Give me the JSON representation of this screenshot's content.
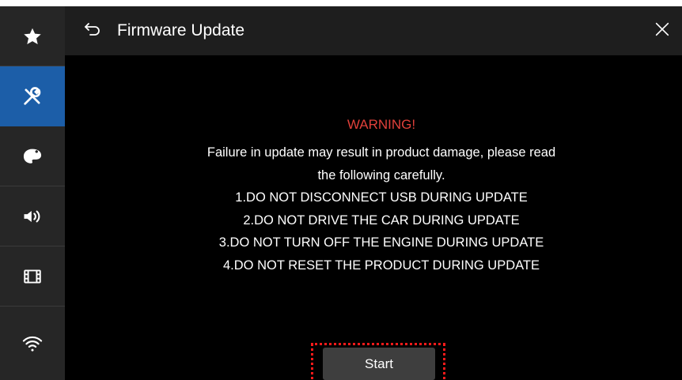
{
  "header": {
    "title": "Firmware Update",
    "back_icon": "back-arrow-icon",
    "close_icon": "close-icon"
  },
  "sidebar": {
    "items": [
      {
        "name": "favorites",
        "icon": "star-icon",
        "active": false
      },
      {
        "name": "settings",
        "icon": "tools-icon",
        "active": true
      },
      {
        "name": "theme",
        "icon": "palette-icon",
        "active": false
      },
      {
        "name": "audio",
        "icon": "speaker-icon",
        "active": false
      },
      {
        "name": "video",
        "icon": "film-icon",
        "active": false
      },
      {
        "name": "wireless",
        "icon": "wifi-icon",
        "active": false
      }
    ]
  },
  "dialog": {
    "warning_title": "WARNING!",
    "lines": [
      "Failure in update may result in product damage,  please read",
      "the following carefully.",
      "1.DO NOT DISCONNECT USB DURING UPDATE",
      "2.DO NOT DRIVE THE CAR DURING UPDATE",
      "3.DO NOT TURN OFF THE ENGINE DURING UPDATE",
      "4.DO NOT RESET THE PRODUCT DURING UPDATE"
    ],
    "start_label": "Start"
  },
  "colors": {
    "background": "#000000",
    "sidebar": "#262626",
    "header": "#1e1e1e",
    "active_item": "#1c5ea8",
    "warning": "#e0403a",
    "button": "#3e3e3e",
    "highlight": "#ff1a1a"
  }
}
